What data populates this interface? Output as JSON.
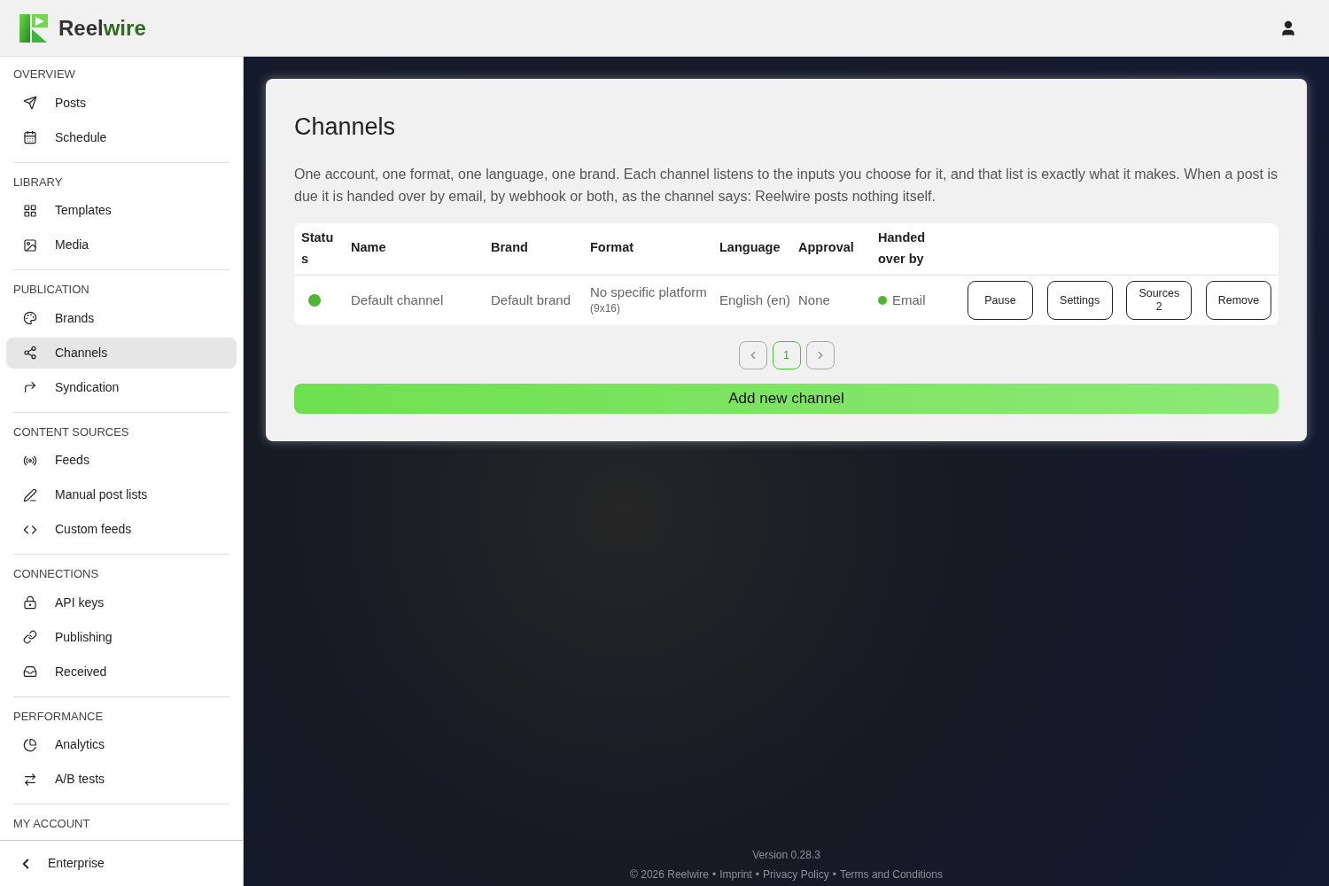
{
  "header": {
    "logo": {
      "part_1": "Reel",
      "part_2": "wire"
    }
  },
  "sidebar": {
    "sections": [
      {
        "title": "OVERVIEW",
        "items": [
          {
            "label": "Posts",
            "selected": false
          },
          {
            "label": "Schedule",
            "selected": false
          }
        ]
      },
      {
        "title": "LIBRARY",
        "items": [
          {
            "label": "Templates",
            "selected": false
          },
          {
            "label": "Media",
            "selected": false
          }
        ]
      },
      {
        "title": "PUBLICATION",
        "items": [
          {
            "label": "Brands",
            "selected": false
          },
          {
            "label": "Channels",
            "selected": true
          },
          {
            "label": "Syndication",
            "selected": false
          }
        ]
      },
      {
        "title": "CONTENT SOURCES",
        "items": [
          {
            "label": "Feeds",
            "selected": false
          },
          {
            "label": "Manual post lists",
            "selected": false
          },
          {
            "label": "Custom feeds",
            "selected": false
          }
        ]
      },
      {
        "title": "CONNECTIONS",
        "items": [
          {
            "label": "API keys",
            "selected": false
          },
          {
            "label": "Publishing",
            "selected": false
          },
          {
            "label": "Received",
            "selected": false
          }
        ]
      },
      {
        "title": "PERFORMANCE",
        "items": [
          {
            "label": "Analytics",
            "selected": false
          },
          {
            "label": "A/B tests",
            "selected": false
          }
        ]
      },
      {
        "title": "MY ACCOUNT"
      }
    ],
    "footer_item": "Enterprise"
  },
  "page": {
    "title": "Channels",
    "description": "One account, one format, one language, one brand. Each channel listens to the inputs you choose for it, and that list is exactly what it makes. When a post is due it is handed over by email, by webhook or both, as the channel says: Reelwire posts nothing itself.",
    "table": {
      "columns": [
        "Status",
        "Name",
        "Brand",
        "Format",
        "Language",
        "Approval",
        "Handed over by"
      ],
      "rows": [
        {
          "color": "#4cb82f",
          "name": "Default channel",
          "brand": "Default brand",
          "format": "No specific platform",
          "format_detail": "(9x16)",
          "language": "English (en)",
          "approval": "None",
          "handover": {
            "label": "Email",
            "color": "#4cb82f"
          },
          "buttons": [
            "Pause",
            "Settings",
            "Sources\n2",
            "Remove"
          ]
        }
      ]
    },
    "pagination": {
      "pages": [
        {
          "label": "1",
          "selected": true
        }
      ]
    },
    "add_button": "Add new channel"
  },
  "footer": {
    "version": "Version 0.28.3",
    "copyright": "© 2026 Reelwire",
    "separator": "•",
    "links": [
      "Imprint",
      "Privacy Policy",
      "Terms and Conditions"
    ]
  }
}
